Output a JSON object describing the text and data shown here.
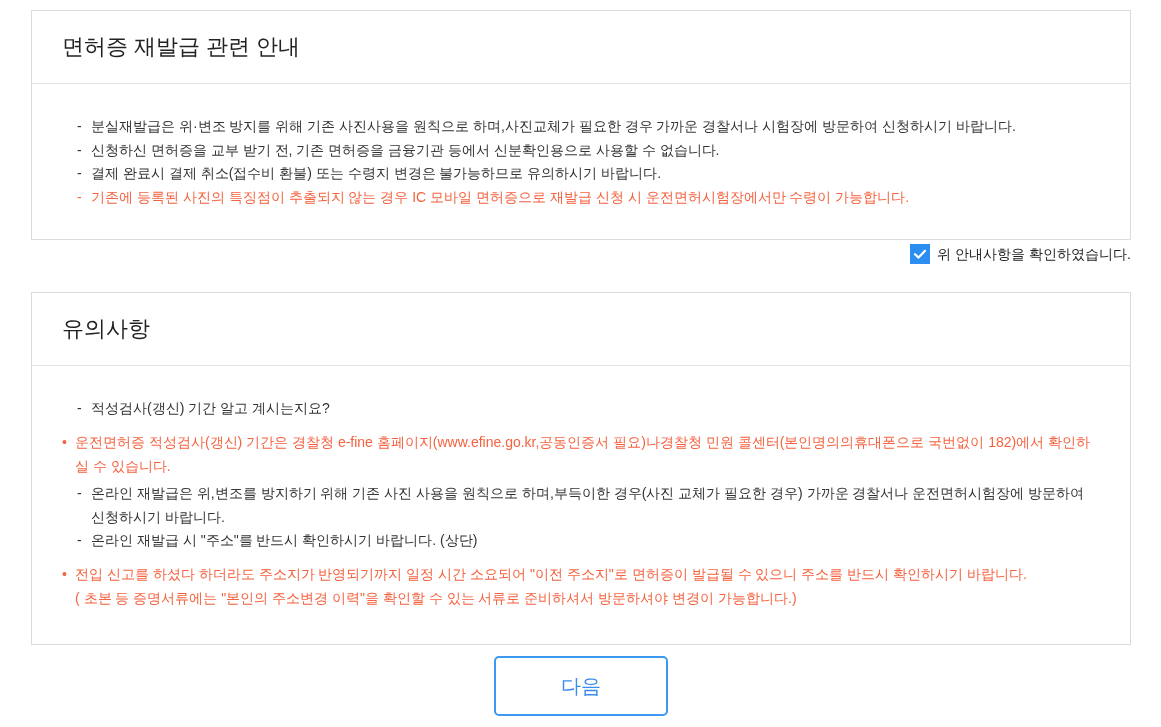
{
  "notice": {
    "title": "면허증 재발급 관련 안내",
    "items": [
      {
        "kind": "dash",
        "marker": "-",
        "emphasis": false,
        "text": "분실재발급은 위·변조 방지를 위해 기존 사진사용을 원칙으로 하며,사진교체가 필요한 경우 가까운 경찰서나 시험장에 방문하여 신청하시기 바랍니다."
      },
      {
        "kind": "dash",
        "marker": "-",
        "emphasis": false,
        "text": "신청하신 면허증을 교부 받기 전, 기존 면허증을 금융기관 등에서 신분확인용으로 사용할 수 없습니다."
      },
      {
        "kind": "dash",
        "marker": "-",
        "emphasis": false,
        "text": "결제 완료시 결제 취소(접수비 환불) 또는 수령지 변경은 불가능하므로 유의하시기 바랍니다."
      },
      {
        "kind": "dash",
        "marker": "-",
        "emphasis": true,
        "text": "기존에 등록된 사진의 특징점이 추출되지 않는 경우 IC 모바일 면허증으로 재발급 신청 시 운전면허시험장에서만 수령이 가능합니다."
      }
    ]
  },
  "confirmation": {
    "label": "위 안내사항을 확인하였습니다.",
    "checked": true
  },
  "cautions": {
    "title": "유의사항",
    "items": [
      {
        "kind": "dash",
        "marker": "-",
        "emphasis": false,
        "text": "적성검사(갱신) 기간 알고 계시는지요?"
      },
      {
        "kind": "bullet",
        "marker": "•",
        "emphasis": true,
        "text": "운전면허증 적성검사(갱신) 기간은 경찰청 e-fine 홈페이지(www.efine.go.kr,공동인증서 필요)나경찰청 민원 콜센터(본인명의의휴대폰으로 국번없이 182)에서 확인하실 수 있습니다."
      },
      {
        "kind": "dash",
        "marker": "-",
        "emphasis": false,
        "text": "온라인 재발급은 위,변조를 방지하기 위해 기존 사진 사용을 원칙으로 하며,부득이한 경우(사진 교체가 필요한 경우) 가까운 경찰서나 운전면허시험장에 방문하여 신청하시기 바랍니다."
      },
      {
        "kind": "dash",
        "marker": "-",
        "emphasis": false,
        "text": "온라인 재발급 시 \"주소\"를 반드시 확인하시기 바랍니다. (상단)"
      },
      {
        "kind": "bullet",
        "marker": "•",
        "emphasis": true,
        "text": "전입 신고를 하셨다 하더라도 주소지가 반영되기까지 일정 시간 소요되어 \"이전 주소지\"로 면허증이 발급될 수 있으니 주소를 반드시 확인하시기 바랍니다.",
        "note": "( 초본 등 증명서류에는 \"본인의 주소변경 이력\"을 확인할 수 있는 서류로 준비하셔서 방문하셔야 변경이 가능합니다.)"
      }
    ]
  },
  "next_button": {
    "label": "다음"
  }
}
